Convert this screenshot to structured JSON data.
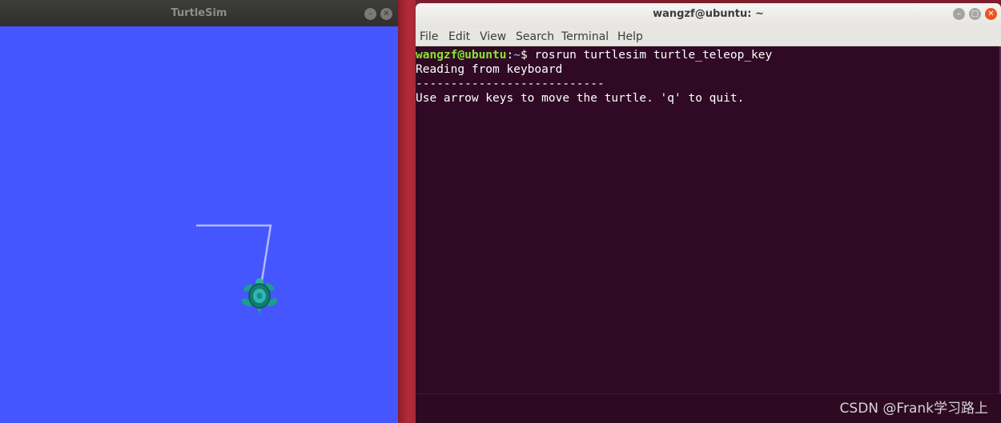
{
  "turtlesim": {
    "title": "TurtleSim",
    "min_glyph": "–",
    "close_glyph": "✕",
    "background_color": "#4556ff",
    "path_color": "#b3b9ff",
    "turtle_icon": "turtle-icon"
  },
  "terminal": {
    "title": "wangzf@ubuntu: ~",
    "window_controls": {
      "minimize": "–",
      "maximize": "□",
      "close": "✕"
    },
    "menu": [
      "File",
      "Edit",
      "View",
      "Search",
      "Terminal",
      "Help"
    ],
    "prompt": {
      "user_host": "wangzf@ubuntu",
      "separator": ":",
      "path": "~",
      "symbol": "$ ",
      "command": "rosrun turtlesim turtle_teleop_key"
    },
    "output": [
      "Reading from keyboard",
      "---------------------------",
      "Use arrow keys to move the turtle. 'q' to quit."
    ],
    "background_color": "#300a24",
    "prompt_user_color": "#8ae234",
    "prompt_path_color": "#729fcf"
  },
  "watermark": "CSDN @Frank学习路上"
}
